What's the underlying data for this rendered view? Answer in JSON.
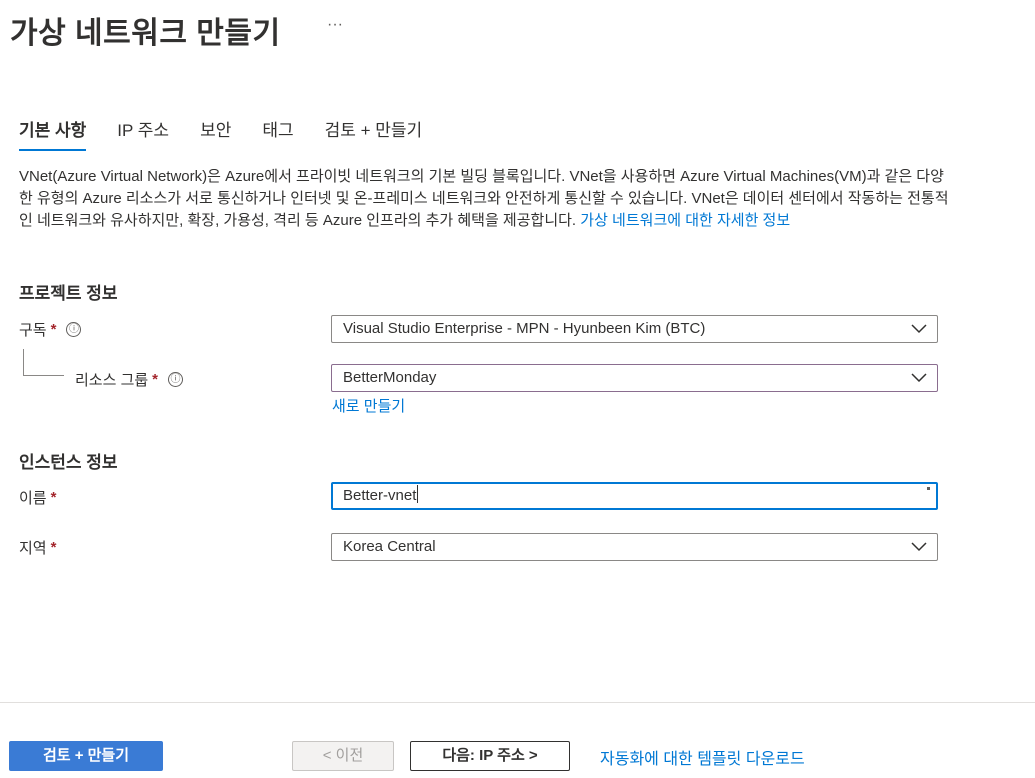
{
  "header": {
    "title": "가상 네트워크 만들기",
    "more_label": "···"
  },
  "tabs": [
    {
      "label": "기본 사항",
      "active": true
    },
    {
      "label": "IP 주소",
      "active": false
    },
    {
      "label": "보안",
      "active": false
    },
    {
      "label": "태그",
      "active": false
    },
    {
      "label": "검토 + 만들기",
      "active": false
    }
  ],
  "description": {
    "text": "VNet(Azure Virtual Network)은 Azure에서 프라이빗 네트워크의 기본 빌딩 블록입니다. VNet을 사용하면 Azure Virtual Machines(VM)과 같은 다양한 유형의 Azure 리소스가 서로 통신하거나 인터넷 및 온-프레미스 네트워크와 안전하게 통신할 수 있습니다. VNet은 데이터 센터에서 작동하는 전통적인 네트워크와 유사하지만, 확장, 가용성, 격리 등 Azure 인프라의 추가 혜택을 제공합니다. ",
    "link": "가상 네트워크에 대한 자세한 정보"
  },
  "project": {
    "heading": "프로젝트 정보",
    "subscription": {
      "label": "구독",
      "required_mark": "*",
      "info_icon": "ⓘ",
      "value": "Visual Studio Enterprise - MPN - Hyunbeen Kim (BTC)"
    },
    "resource_group": {
      "label": "리소스 그룹",
      "required_mark": "*",
      "info_icon": "ⓘ",
      "value": "BetterMonday",
      "create_new": "새로 만들기"
    }
  },
  "instance": {
    "heading": "인스턴스 정보",
    "name": {
      "label": "이름",
      "required_mark": "*",
      "value": "Better-vnet"
    },
    "region": {
      "label": "지역",
      "required_mark": "*",
      "value": "Korea Central"
    }
  },
  "footer": {
    "review_create": "검토 + 만들기",
    "previous": "< 이전",
    "next": "다음: IP 주소 >",
    "template_link": "자동화에 대한 템플릿 다운로드"
  },
  "colors": {
    "accent": "#0078d4",
    "required": "#a4262c",
    "primary_button": "#3a7bd5"
  }
}
